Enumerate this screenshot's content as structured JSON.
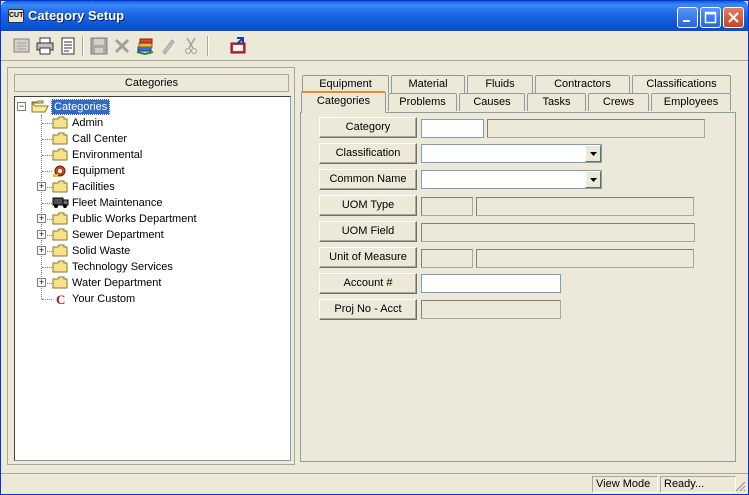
{
  "window": {
    "title": "Category Setup",
    "app_icon_label": "CUT"
  },
  "toolbar": {
    "icons": [
      "list-icon",
      "print-icon",
      "preview-icon",
      "save-icon",
      "delete-icon",
      "stack-icon",
      "edit-icon",
      "cut-icon",
      "exit-icon"
    ]
  },
  "left": {
    "header": "Categories",
    "tree": [
      {
        "label": "Categories",
        "level": 0,
        "expander": "−",
        "icon": "folder-open",
        "selected": true
      },
      {
        "label": "Admin",
        "level": 1,
        "expander": "",
        "icon": "folder"
      },
      {
        "label": "Call Center",
        "level": 1,
        "expander": "",
        "icon": "folder"
      },
      {
        "label": "Environmental",
        "level": 1,
        "expander": "",
        "icon": "folder"
      },
      {
        "label": "Equipment",
        "level": 1,
        "expander": "",
        "icon": "equipment"
      },
      {
        "label": "Facilities",
        "level": 1,
        "expander": "+",
        "icon": "folder"
      },
      {
        "label": "Fleet Maintenance",
        "level": 1,
        "expander": "",
        "icon": "truck"
      },
      {
        "label": "Public Works Department",
        "level": 1,
        "expander": "+",
        "icon": "folder"
      },
      {
        "label": "Sewer Department",
        "level": 1,
        "expander": "+",
        "icon": "folder"
      },
      {
        "label": "Solid Waste",
        "level": 1,
        "expander": "+",
        "icon": "folder"
      },
      {
        "label": "Technology Services",
        "level": 1,
        "expander": "",
        "icon": "folder"
      },
      {
        "label": "Water Department",
        "level": 1,
        "expander": "+",
        "icon": "folder"
      },
      {
        "label": "Your Custom",
        "level": 1,
        "expander": "",
        "icon": "custom"
      }
    ]
  },
  "tabs": {
    "row1": [
      "Equipment",
      "Material",
      "Fluids",
      "Contractors",
      "Classifications"
    ],
    "row2": [
      "Categories",
      "Problems",
      "Causes",
      "Tasks",
      "Crews",
      "Employees"
    ],
    "active": "Categories"
  },
  "form": {
    "category_label": "Category",
    "classification_label": "Classification",
    "common_name_label": "Common  Name",
    "uom_type_label": "UOM Type",
    "uom_field_label": "UOM Field",
    "unit_of_measure_label": "Unit of Measure",
    "account_label": "Account #",
    "proj_no_label": "Proj No - Acct"
  },
  "status": {
    "mode": "View Mode",
    "state": "Ready..."
  }
}
